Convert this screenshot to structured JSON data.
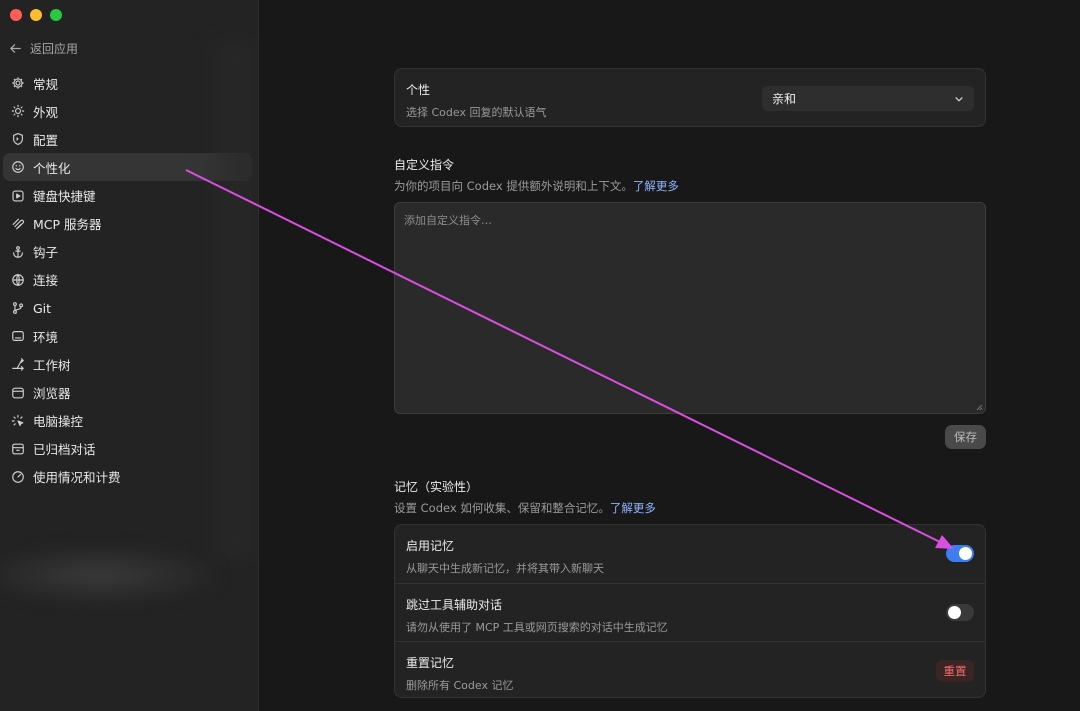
{
  "sidebar": {
    "back_label": "返回应用",
    "items": [
      {
        "label": "常规",
        "icon": "gear-icon"
      },
      {
        "label": "外观",
        "icon": "sun-icon"
      },
      {
        "label": "配置",
        "icon": "shield-icon"
      },
      {
        "label": "个性化",
        "icon": "smile-icon",
        "active": true
      },
      {
        "label": "键盘快捷键",
        "icon": "keyboard-icon"
      },
      {
        "label": "MCP 服务器",
        "icon": "mcp-icon"
      },
      {
        "label": "钩子",
        "icon": "anchor-icon"
      },
      {
        "label": "连接",
        "icon": "globe-icon"
      },
      {
        "label": "Git",
        "icon": "git-branch-icon"
      },
      {
        "label": "环境",
        "icon": "terminal-icon"
      },
      {
        "label": "工作树",
        "icon": "worktree-icon"
      },
      {
        "label": "浏览器",
        "icon": "browser-icon"
      },
      {
        "label": "电脑操控",
        "icon": "cursor-icon"
      },
      {
        "label": "已归档对话",
        "icon": "archive-icon"
      },
      {
        "label": "使用情况和计费",
        "icon": "gauge-icon"
      }
    ]
  },
  "personality": {
    "title": "个性",
    "subtitle": "选择 Codex 回复的默认语气",
    "selected": "亲和"
  },
  "custom_instructions": {
    "title": "自定义指令",
    "subtitle": "为你的项目向 Codex 提供额外说明和上下文。",
    "link": "了解更多",
    "placeholder": "添加自定义指令…",
    "save_label": "保存"
  },
  "memory": {
    "title": "记忆（实验性）",
    "subtitle": "设置 Codex 如何收集、保留和整合记忆。",
    "link": "了解更多",
    "rows": [
      {
        "title": "启用记忆",
        "subtitle": "从聊天中生成新记忆，并将其带入新聊天",
        "toggle": true
      },
      {
        "title": "跳过工具辅助对话",
        "subtitle": "请勿从使用了 MCP 工具或网页搜索的对话中生成记忆",
        "toggle": false
      },
      {
        "title": "重置记忆",
        "subtitle": "删除所有 Codex 记忆",
        "button": "重置"
      }
    ]
  },
  "colors": {
    "accent": "#3a7ef0",
    "annotation_arrow": "#d94fe0",
    "danger": "#ef6b6b"
  }
}
